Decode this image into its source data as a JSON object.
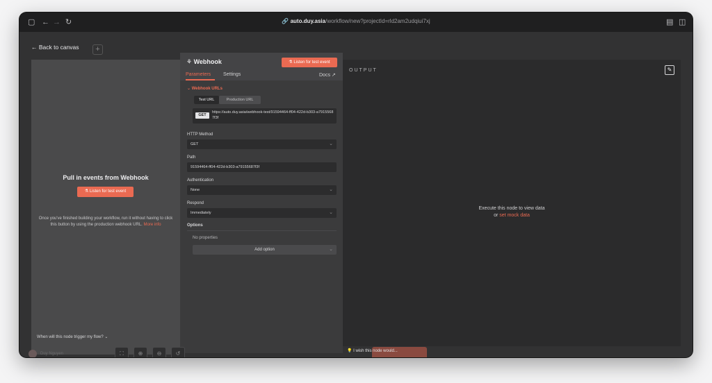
{
  "browser": {
    "url_host": "auto.duy.asia",
    "url_path": "/workflow/new?projectId=rld2am2udqiui7xj"
  },
  "left_panel": {
    "back_label": "Back to canvas",
    "title": "Pull in events from Webhook",
    "listen_label": "Listen for test event",
    "description": "Once you've finished building your workflow, run it without having to click this button by using the production webhook URL.",
    "more_info": "More info",
    "footer": "When will this node trigger my flow?"
  },
  "node": {
    "title": "Webhook",
    "listen_label": "Listen for test event",
    "tabs": [
      {
        "label": "Parameters"
      },
      {
        "label": "Settings"
      }
    ],
    "docs_label": "Docs",
    "webhook_section": "Webhook URLs",
    "url_tabs": [
      {
        "label": "Test URL"
      },
      {
        "label": "Production URL"
      }
    ],
    "method_badge": "GET",
    "webhook_url": "https://auto.duy.asia/webhook-test/91594464-ff04-422d-b303-a79155687f3f",
    "fields": {
      "http_method": {
        "label": "HTTP Method",
        "value": "GET"
      },
      "path": {
        "label": "Path",
        "value": "91594464-ff04-422d-b303-a79155687f3f"
      },
      "authentication": {
        "label": "Authentication",
        "value": "None"
      },
      "respond": {
        "label": "Respond",
        "value": "Immediately"
      }
    },
    "options_label": "Options",
    "no_properties": "No properties",
    "add_option": "Add option"
  },
  "output": {
    "label": "OUTPUT",
    "message_line1": "Execute this node to view data",
    "message_or": "or",
    "mock_link": "set mock data"
  },
  "bottom": {
    "wish": "I wish this node would...",
    "user_name": "Duy Nguyen"
  },
  "colors": {
    "accent": "#ea6a52",
    "panel_dark": "#2b2b2c",
    "panel_mid": "#3b3b3c"
  }
}
